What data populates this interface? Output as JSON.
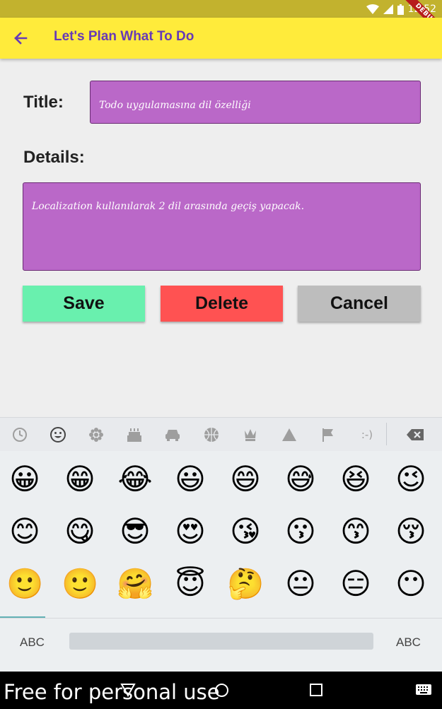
{
  "status_bar": {
    "time": "12:52",
    "debug_label": "DEBUG"
  },
  "app_bar": {
    "title": "Let's Plan What To Do"
  },
  "form": {
    "title_label": "Title:",
    "title_value": "Todo uygulamasına dil özelliği",
    "details_label": "Details:",
    "details_value": "Localization kullanılarak 2 dil arasında geçiş yapacak."
  },
  "buttons": {
    "save": "Save",
    "delete": "Delete",
    "cancel": "Cancel"
  },
  "colors": {
    "app_bar": "#ffeb3b",
    "title_text": "#673ab7",
    "field": "#ba68c8",
    "save": "#69f0ae",
    "delete": "#ff5252",
    "cancel": "#bdbdbd"
  },
  "keyboard": {
    "categories": [
      "recent-icon",
      "smiley-icon",
      "nature-icon",
      "food-icon",
      "travel-icon",
      "activity-icon",
      "objects-icon",
      "symbols-icon",
      "flags-icon",
      "emoticons-icon"
    ],
    "emoticon_text": ":-)",
    "emoji_rows": [
      [
        "😀",
        "😁",
        "😂",
        "😃",
        "😄",
        "😅",
        "😆",
        "😉"
      ],
      [
        "😊",
        "😋",
        "😎",
        "😍",
        "😘",
        "😗",
        "😙",
        "😚"
      ],
      [
        "🙂",
        "🙂",
        "🤗",
        "😇",
        "🤔",
        "😐",
        "😑",
        "😶"
      ]
    ],
    "abc_left": "ABC",
    "abc_right": "ABC"
  },
  "watermark": "Free for personal use"
}
